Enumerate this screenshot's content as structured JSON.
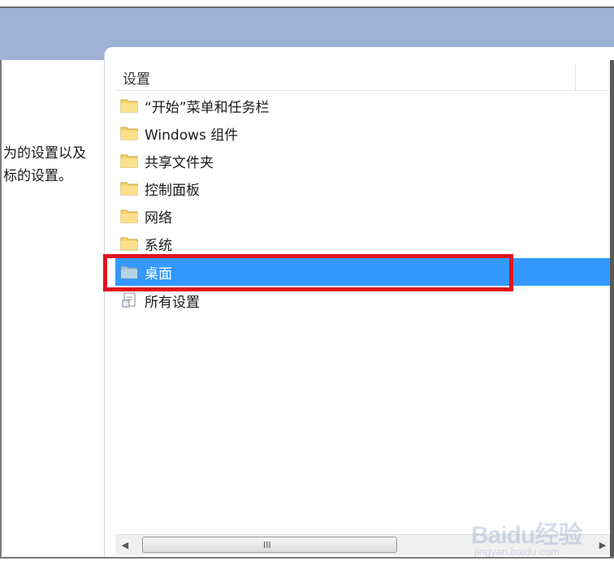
{
  "left_pane": {
    "line1": "为的设置以及",
    "line2": "标的设置。"
  },
  "list": {
    "column_header": "设置",
    "items": [
      {
        "label": "“开始”菜单和任务栏",
        "icon": "folder-icon",
        "selected": false
      },
      {
        "label": "Windows 组件",
        "icon": "folder-icon",
        "selected": false
      },
      {
        "label": "共享文件夹",
        "icon": "folder-icon",
        "selected": false
      },
      {
        "label": "控制面板",
        "icon": "folder-icon",
        "selected": false
      },
      {
        "label": "网络",
        "icon": "folder-icon",
        "selected": false
      },
      {
        "label": "系统",
        "icon": "folder-icon",
        "selected": false
      },
      {
        "label": "桌面",
        "icon": "folder-icon",
        "selected": true
      },
      {
        "label": "所有设置",
        "icon": "settings-page-icon",
        "selected": false
      }
    ]
  },
  "scrollbar": {
    "left_arrow": "◀",
    "right_arrow": "▶",
    "grip": "III"
  },
  "watermark": {
    "brand": "Baidu经验",
    "url": "jingyan.baidu.com"
  },
  "colors": {
    "header_band": "#9db2d4",
    "selection": "#3399ff",
    "highlight_border": "#e0141e",
    "folder": "#f5d36b"
  }
}
